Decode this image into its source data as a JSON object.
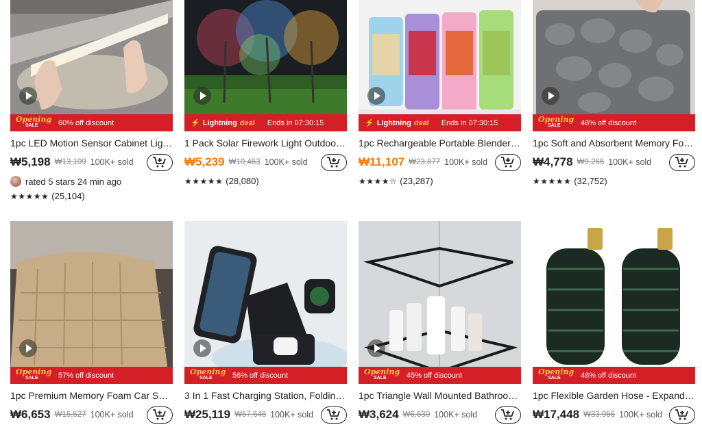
{
  "products": [
    {
      "title": "1pc LED Motion Sensor Cabinet Light...",
      "price": "₩5,198",
      "orig": "₩13,109",
      "sold": "100K+ sold",
      "banner": "60% off discount",
      "reviews": "(25,104)",
      "rated": "rated 5 stars 24 min ago",
      "stars": "★★★★★"
    },
    {
      "title": "1 Pack Solar Firework Light Outdoor, ...",
      "price": "₩5,239",
      "orig": "₩10,463",
      "sold": "100K+ sold",
      "lightning": "Lightning",
      "deal": "deal",
      "ends": "Ends in 07:30:15",
      "reviews": "(28,080)",
      "stars": "★★★★★"
    },
    {
      "title": "1pc Rechargeable Portable Blender w...",
      "price": "₩11,107",
      "orig": "₩23,877",
      "sold": "100K+ sold",
      "lightning": "Lightning",
      "deal": "deal",
      "ends": "Ends in 07:30:15",
      "reviews": "(23,287)",
      "stars": "★★★★☆"
    },
    {
      "title": "1pc Soft and Absorbent Memory Foa...",
      "price": "₩4,778",
      "orig": "₩9,266",
      "sold": "100K+ sold",
      "banner": "48% off discount",
      "reviews": "(32,752)",
      "stars": "★★★★★"
    },
    {
      "title": "1pc Premium Memory Foam Car Seat...",
      "price": "₩6,653",
      "orig": "₩15,527",
      "sold": "100K+ sold",
      "banner": "57% off discount"
    },
    {
      "title": "3 In 1 Fast Charging Station, Folding ...",
      "price": "₩25,119",
      "orig": "₩57,648",
      "sold": "100K+ sold",
      "banner": "56% off discount"
    },
    {
      "title": "1pc Triangle Wall Mounted Bathroom ...",
      "price": "₩3,624",
      "orig": "₩6,630",
      "sold": "100K+ sold",
      "banner": "45% off discount"
    },
    {
      "title": "1pc Flexible Garden Hose - Expanda...",
      "price": "₩17,448",
      "orig": "₩33,956",
      "sold": "100K+ sold",
      "banner": "48% off discount"
    }
  ],
  "badge": {
    "line1": "Opening",
    "line2": "SALE"
  },
  "colors": {
    "accent": "#fb7701",
    "banner": "#d31f25",
    "gold": "#f7c844"
  },
  "icons": {
    "cart": "add-to-cart-icon",
    "play": "play-icon",
    "bolt": "lightning-icon"
  }
}
